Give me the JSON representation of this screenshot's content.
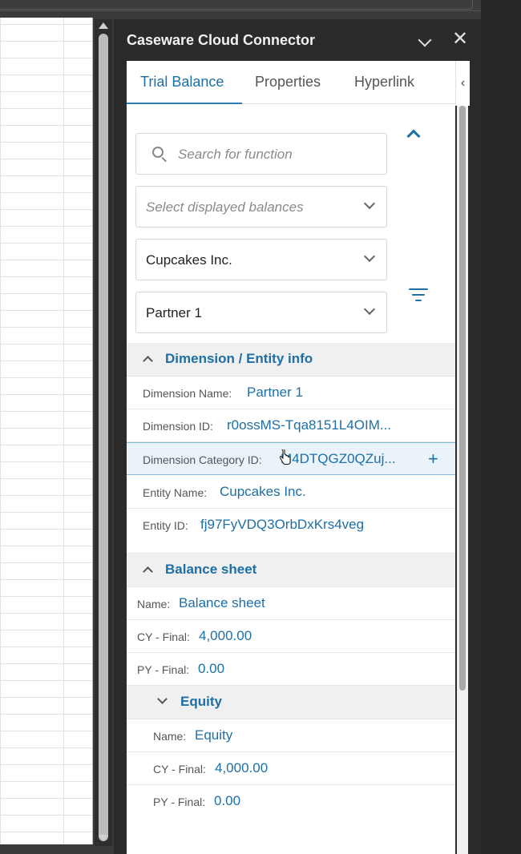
{
  "pane": {
    "title": "Caseware Cloud Connector",
    "collapse_icon": "chevron-down-icon",
    "close_icon": "close-icon",
    "close_glyph": "✕"
  },
  "tabs": [
    {
      "label": "Trial Balance",
      "active": true
    },
    {
      "label": "Properties",
      "active": false
    },
    {
      "label": "Hyperlink",
      "active": false
    }
  ],
  "side_tab_glyph": "‹",
  "search": {
    "placeholder": "Search for function"
  },
  "balances_select": {
    "placeholder": "Select displayed balances"
  },
  "entity_select": {
    "value": "Cupcakes Inc."
  },
  "dimension_select": {
    "value": "Partner 1"
  },
  "dimension_section": {
    "title": "Dimension / Entity info",
    "rows": [
      {
        "key": "Dimension Name:",
        "value": "Partner 1"
      },
      {
        "key": "Dimension ID:",
        "value": "r0ossMS-Tqa8151L4OIM..."
      },
      {
        "key": "Dimension Category ID:",
        "value": "M4DTQGZ0QZuj..."
      },
      {
        "key": "Entity Name:",
        "value": "Cupcakes Inc."
      },
      {
        "key": "Entity ID:",
        "value": "fj97FyVDQ3OrbDxKrs4veg"
      }
    ],
    "add_glyph": "+"
  },
  "balance_sheet": {
    "title": "Balance sheet",
    "rows": [
      {
        "key": "Name:",
        "value": "Balance sheet"
      },
      {
        "key": "CY - Final:",
        "value": "4,000.00"
      },
      {
        "key": "PY - Final:",
        "value": "0.00"
      }
    ]
  },
  "equity": {
    "title": "Equity",
    "rows": [
      {
        "key": "Name:",
        "value": "Equity"
      },
      {
        "key": "CY - Final:",
        "value": "4,000.00"
      },
      {
        "key": "PY - Final:",
        "value": "0.00"
      }
    ]
  },
  "colors": {
    "accent": "#1d6fa5",
    "pane_bg": "#2b2b2b",
    "section_bg": "#f0f0f0",
    "highlight_row": "#eaf3fa"
  }
}
